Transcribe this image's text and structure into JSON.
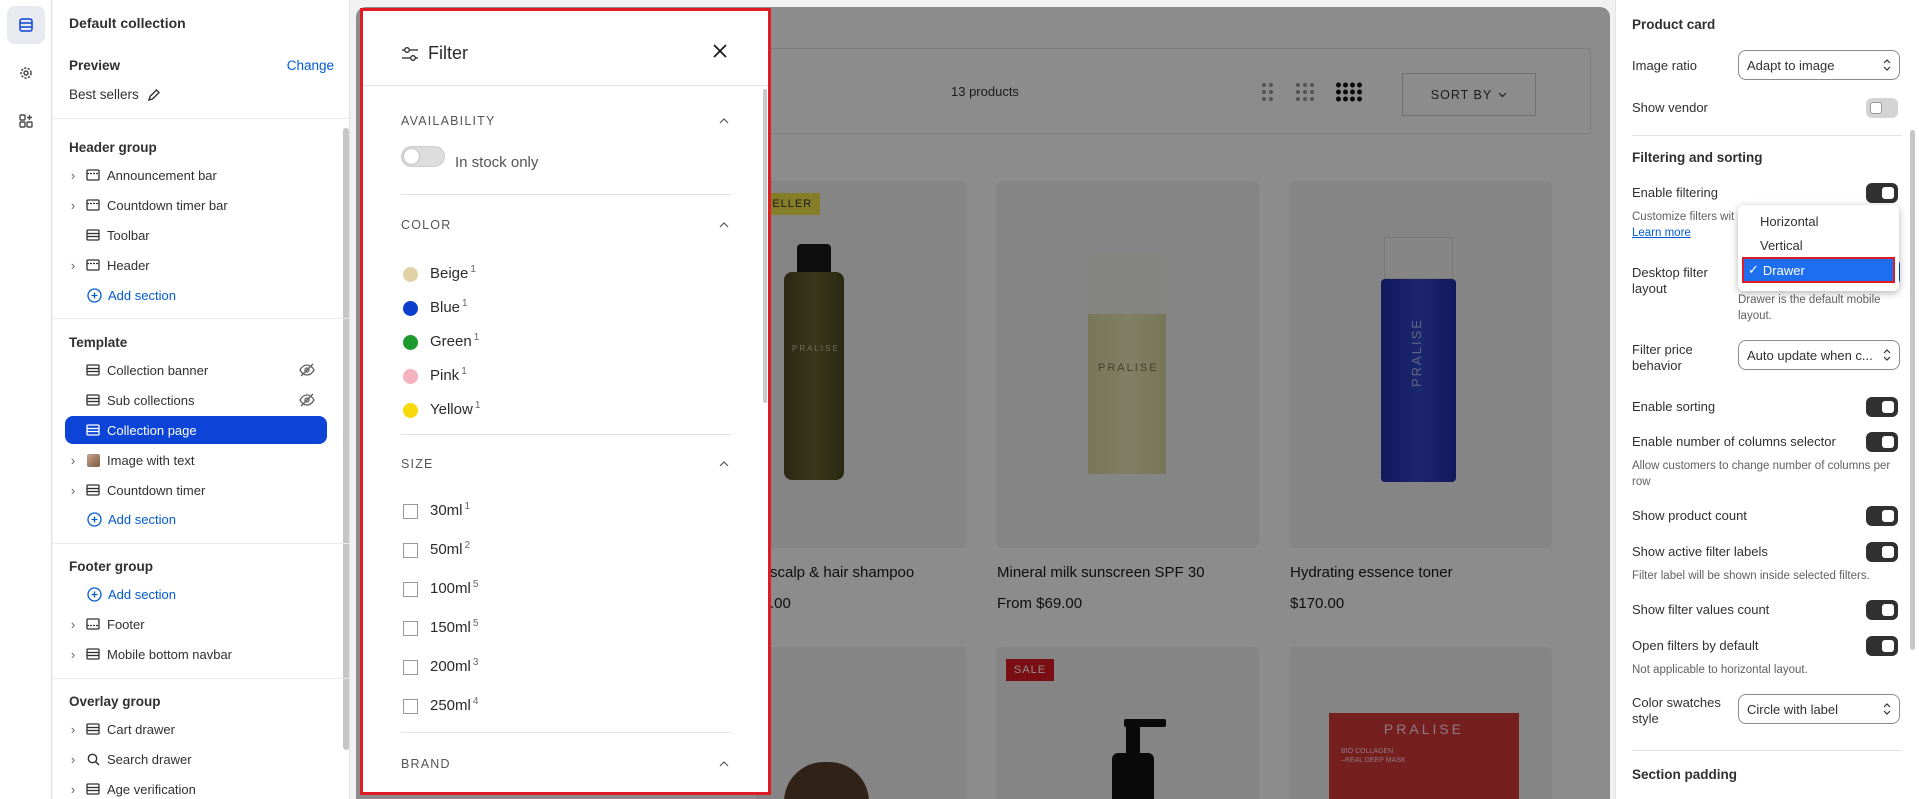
{
  "sidebar": {
    "title": "Default collection",
    "preview_label": "Preview",
    "change_link": "Change",
    "preview_value": "Best sellers",
    "header_group": {
      "title": "Header group",
      "items": [
        {
          "label": "Announcement bar"
        },
        {
          "label": "Countdown timer bar"
        },
        {
          "label": "Toolbar"
        },
        {
          "label": "Header"
        }
      ],
      "add": "Add section"
    },
    "template": {
      "title": "Template",
      "items": [
        {
          "label": "Collection banner"
        },
        {
          "label": "Sub collections"
        },
        {
          "label": "Collection page"
        },
        {
          "label": "Image with text"
        },
        {
          "label": "Countdown timer"
        }
      ],
      "add": "Add section"
    },
    "footer_group": {
      "title": "Footer group",
      "add": "Add section",
      "items": [
        {
          "label": "Footer"
        },
        {
          "label": "Mobile bottom navbar"
        }
      ]
    },
    "overlay_group": {
      "title": "Overlay group",
      "items": [
        {
          "label": "Cart drawer"
        },
        {
          "label": "Search drawer"
        },
        {
          "label": "Age verification"
        }
      ]
    }
  },
  "storefront": {
    "product_count": "13 products",
    "sort_by": "SORT BY",
    "badges": {
      "best_seller": "SELLER",
      "sale": "SALE"
    },
    "brand_text": "PRALISE",
    "products": [
      {
        "title": "scalp & hair shampoo",
        "price": ".00"
      },
      {
        "title": "Mineral milk sunscreen SPF 30",
        "price": "From $69.00"
      },
      {
        "title": "Hydrating essence toner",
        "price": "$170.00"
      }
    ],
    "bottom_product_text": "BIO COLLAGEN\n–REAL DEEP MASK"
  },
  "filter": {
    "title": "Filter",
    "availability": {
      "heading": "AVAILABILITY",
      "in_stock": "In stock only"
    },
    "color": {
      "heading": "COLOR",
      "options": [
        {
          "label": "Beige",
          "count": "1",
          "color": "#e1d1a7"
        },
        {
          "label": "Blue",
          "count": "1",
          "color": "#0b3fcc"
        },
        {
          "label": "Green",
          "count": "1",
          "color": "#1d9a2d"
        },
        {
          "label": "Pink",
          "count": "1",
          "color": "#f5b3c2"
        },
        {
          "label": "Yellow",
          "count": "1",
          "color": "#f7d90c"
        }
      ]
    },
    "size": {
      "heading": "SIZE",
      "options": [
        {
          "label": "30ml",
          "count": "1"
        },
        {
          "label": "50ml",
          "count": "2"
        },
        {
          "label": "100ml",
          "count": "5"
        },
        {
          "label": "150ml",
          "count": "5"
        },
        {
          "label": "200ml",
          "count": "3"
        },
        {
          "label": "250ml",
          "count": "4"
        }
      ]
    },
    "brand": {
      "heading": "BRAND"
    }
  },
  "settings": {
    "product_card": {
      "title": "Product card",
      "image_ratio_label": "Image ratio",
      "image_ratio_value": "Adapt to image",
      "show_vendor": "Show vendor"
    },
    "filtering": {
      "title": "Filtering and sorting",
      "enable_filtering": "Enable filtering",
      "customize_help": "Customize filters wit",
      "learn_more": "Learn more",
      "desktop_layout_label": "Desktop filter layout",
      "drawer_help": "Drawer is the default mobile layout.",
      "price_behavior_label": "Filter price behavior",
      "price_behavior_value": "Auto update when c...",
      "enable_sorting": "Enable sorting",
      "columns_selector": "Enable number of columns selector",
      "columns_help": "Allow customers to change number of columns per row",
      "show_count": "Show product count",
      "active_labels": "Show active filter labels",
      "active_help": "Filter label will be shown inside selected filters.",
      "values_count": "Show filter values count",
      "open_default": "Open filters by default",
      "open_help": "Not applicable to horizontal layout.",
      "swatch_style_label": "Color swatches style",
      "swatch_style_value": "Circle with label"
    },
    "section_padding": "Section padding",
    "layout_menu": {
      "options": [
        "Horizontal",
        "Vertical",
        "Drawer"
      ],
      "selected": "Drawer",
      "checkmark": "✓"
    }
  },
  "colors": {
    "accent": "#0b44d6",
    "link": "#005bd3",
    "highlight": "#e01b24"
  }
}
